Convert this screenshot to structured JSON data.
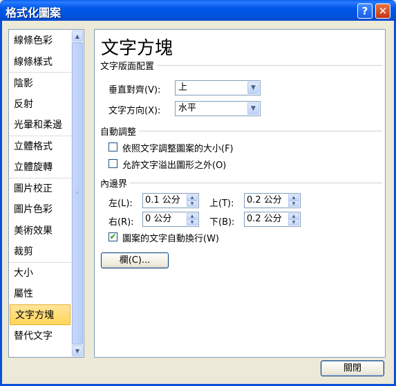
{
  "window": {
    "title": "格式化圖案",
    "help_label": "?",
    "close_label": "✕"
  },
  "nav": {
    "items": [
      {
        "label": "線條色彩"
      },
      {
        "label": "線條樣式"
      },
      {
        "label": "陰影"
      },
      {
        "label": "反射"
      },
      {
        "label": "光暈和柔邊"
      },
      {
        "label": "立體格式"
      },
      {
        "label": "立體旋轉"
      },
      {
        "label": "圖片校正"
      },
      {
        "label": "圖片色彩"
      },
      {
        "label": "美術效果"
      },
      {
        "label": "裁剪"
      },
      {
        "label": "大小"
      },
      {
        "label": "屬性"
      },
      {
        "label": "文字方塊"
      },
      {
        "label": "替代文字"
      }
    ],
    "active": "文字方塊"
  },
  "panel": {
    "title": "文字方塊",
    "layout_section": "文字版面配置",
    "vertical_align_label": "垂直對齊(V):",
    "vertical_align_value": "上",
    "text_direction_label": "文字方向(X):",
    "text_direction_value": "水平",
    "autofit_section": "自動調整",
    "resize_label": "依照文字調整圖案的大小(F)",
    "resize_checked": false,
    "overflow_label": "允許文字溢出圖形之外(O)",
    "overflow_checked": false,
    "margins_section": "內邊界",
    "left_label": "左(L):",
    "left_value": "0.1 公分",
    "top_label": "上(T):",
    "top_value": "0.2 公分",
    "right_label": "右(R):",
    "right_value": "0 公分",
    "bottom_label": "下(B):",
    "bottom_value": "0.2 公分",
    "wrap_label": "圖案的文字自動換行(W)",
    "wrap_checked": true,
    "columns_button": "欄(C)..."
  },
  "footer": {
    "close_button": "關閉"
  }
}
